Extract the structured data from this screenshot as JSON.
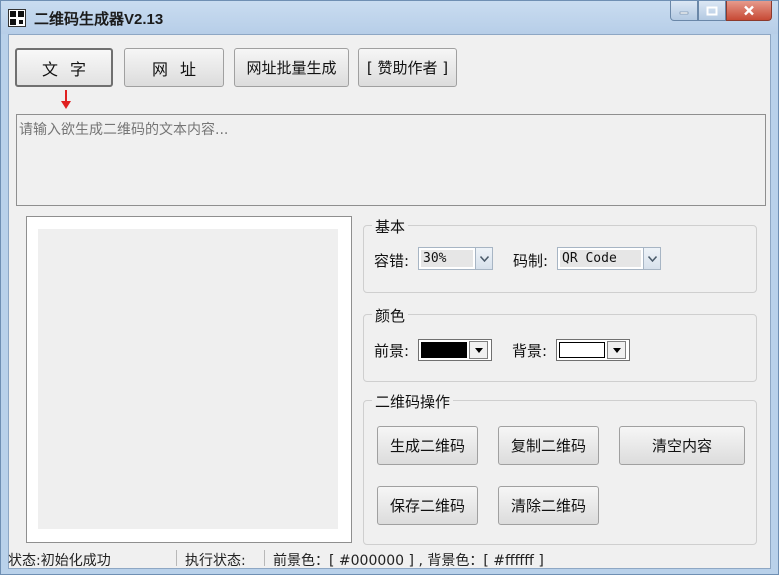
{
  "window": {
    "title": "二维码生成器V2.13",
    "minimize_icon": "minimize-icon",
    "maximize_icon": "maximize-icon",
    "close_icon": "close-icon"
  },
  "tabs": {
    "text_label": "文字",
    "url_label": "网址",
    "batch_label": "网址批量生成",
    "donate_label": "[ 赞助作者 ]",
    "active": "text"
  },
  "input": {
    "placeholder": "请输入欲生成二维码的文本内容..."
  },
  "basic": {
    "title": "基本",
    "error_label": "容错:",
    "error_value": "30%",
    "code_label": "码制:",
    "code_value": "QR Code"
  },
  "color": {
    "title": "颜色",
    "fg_label": "前景:",
    "fg_value": "#000000",
    "bg_label": "背景:",
    "bg_value": "#ffffff"
  },
  "ops": {
    "title": "二维码操作",
    "generate": "生成二维码",
    "copy": "复制二维码",
    "clear_content": "清空内容",
    "save": "保存二维码",
    "clear_code": "清除二维码"
  },
  "status": {
    "state": "状态:初始化成功",
    "exec": "执行状态:",
    "colors": "前景色：[ #000000 ] , 背景色：[ #ffffff ]"
  },
  "accent": {
    "arrow": "#e02020"
  }
}
